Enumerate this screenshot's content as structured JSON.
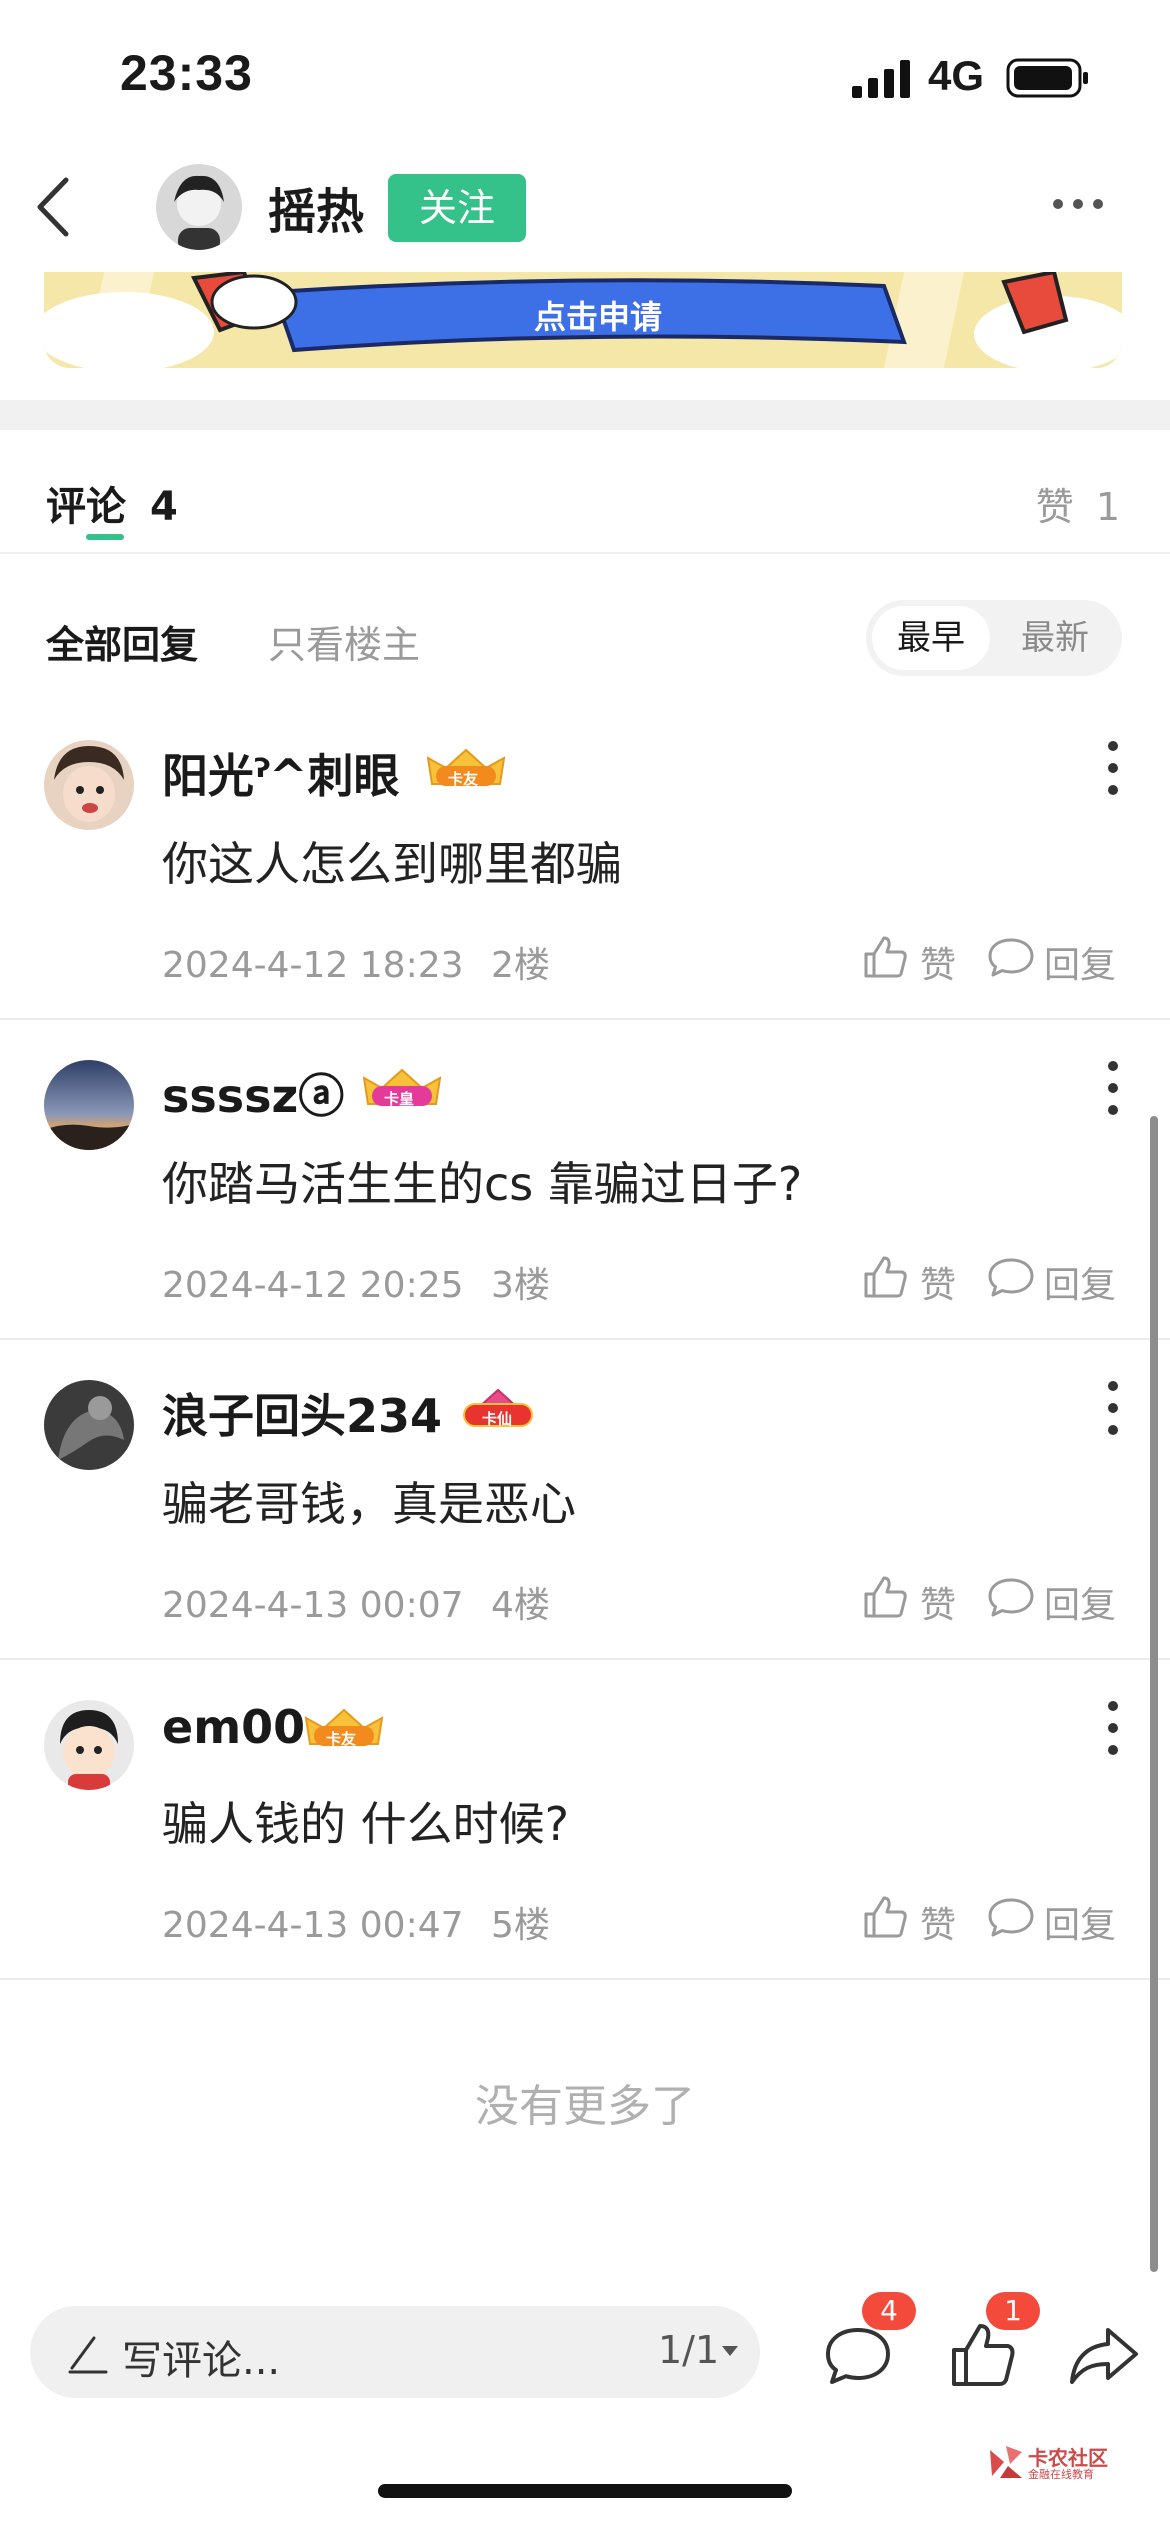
{
  "status_bar": {
    "time": "23:33",
    "network": "4G"
  },
  "header": {
    "username": "摇热",
    "follow_label": "关注"
  },
  "banner": {
    "label": "点击申请"
  },
  "tabs": {
    "comments_label": "评论",
    "comments_count": "4",
    "likes_label": "赞",
    "likes_count": "1"
  },
  "filter": {
    "all": "全部回复",
    "owner_only": "只看楼主",
    "sort_earliest": "最早",
    "sort_latest": "最新"
  },
  "comments": [
    {
      "name": "阳光ˀ^刺眼",
      "badge": "卡友",
      "text": "你这人怎么到哪里都骗",
      "date": "2024-4-12 18:23",
      "floor": "2楼",
      "like_label": "赞",
      "reply_label": "回复"
    },
    {
      "name": "sssszⓐ",
      "badge": "卡皇",
      "text": "你踏马活生生的cs 靠骗过日子?",
      "date": "2024-4-12 20:25",
      "floor": "3楼",
      "like_label": "赞",
      "reply_label": "回复"
    },
    {
      "name": "浪子回头234",
      "badge": "卡仙",
      "text": "骗老哥钱，真是恶心",
      "date": "2024-4-13 00:07",
      "floor": "4楼",
      "like_label": "赞",
      "reply_label": "回复"
    },
    {
      "name": "em00",
      "badge": "卡友",
      "text": "骗人钱的 什么时候?",
      "date": "2024-4-13 00:47",
      "floor": "5楼",
      "like_label": "赞",
      "reply_label": "回复"
    }
  ],
  "footer": {
    "no_more": "没有更多了"
  },
  "bottom_bar": {
    "placeholder": "写评论...",
    "page_indicator": "1/1",
    "comment_count": "4",
    "like_count": "1"
  },
  "watermark": {
    "name": "卡农社区",
    "sub": "金融在线教育"
  },
  "colors": {
    "accent_green": "#35c18a",
    "badge_red": "#f44a3c",
    "muted_gray": "#9a9a9a"
  }
}
